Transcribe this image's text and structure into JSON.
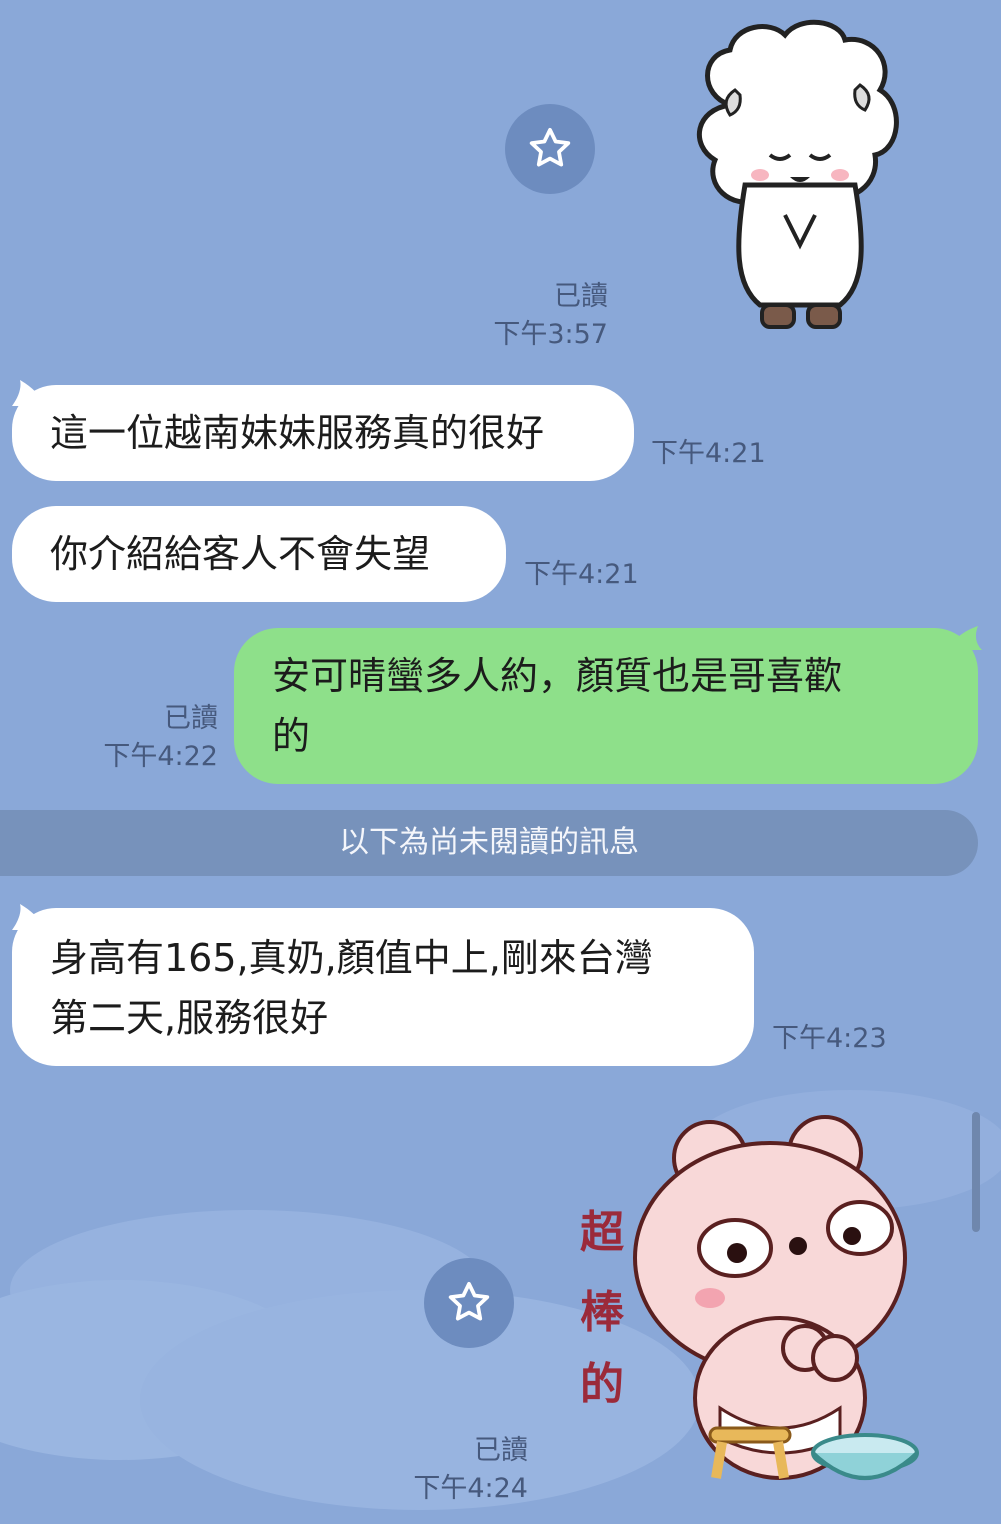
{
  "messages": [
    {
      "type": "sticker",
      "direction": "out",
      "sticker": "sheep-bowing-sticker",
      "read": "已讀",
      "time": "下午3:57"
    },
    {
      "type": "text",
      "direction": "in",
      "text": "這一位越南妹妹服務真的很好",
      "time": "下午4:21"
    },
    {
      "type": "text",
      "direction": "in",
      "text": "你介紹給客人不會失望",
      "time": "下午4:21"
    },
    {
      "type": "text",
      "direction": "out",
      "lines": [
        "安可晴蠻多人約，顏質也是哥喜歡",
        "的"
      ],
      "read": "已讀",
      "time": "下午4:22"
    },
    {
      "type": "text",
      "direction": "in",
      "lines": [
        "身高有165,真奶,顏值中上,剛來台灣",
        "第二天,服務很好"
      ],
      "time": "下午4:23"
    },
    {
      "type": "sticker",
      "direction": "out",
      "sticker": "bear-super-great-sticker",
      "sticker_text": [
        "超",
        "棒",
        "的"
      ],
      "read": "已讀",
      "time": "下午4:24"
    }
  ],
  "divider": {
    "label": "以下為尚未閱讀的訊息"
  },
  "icons": {
    "favorite": "star-icon",
    "scroll": "scrollbar"
  },
  "colors": {
    "background": "#8aa8d8",
    "incoming": "#ffffff",
    "outgoing": "#8ee08a",
    "divider": "#7792bb"
  }
}
